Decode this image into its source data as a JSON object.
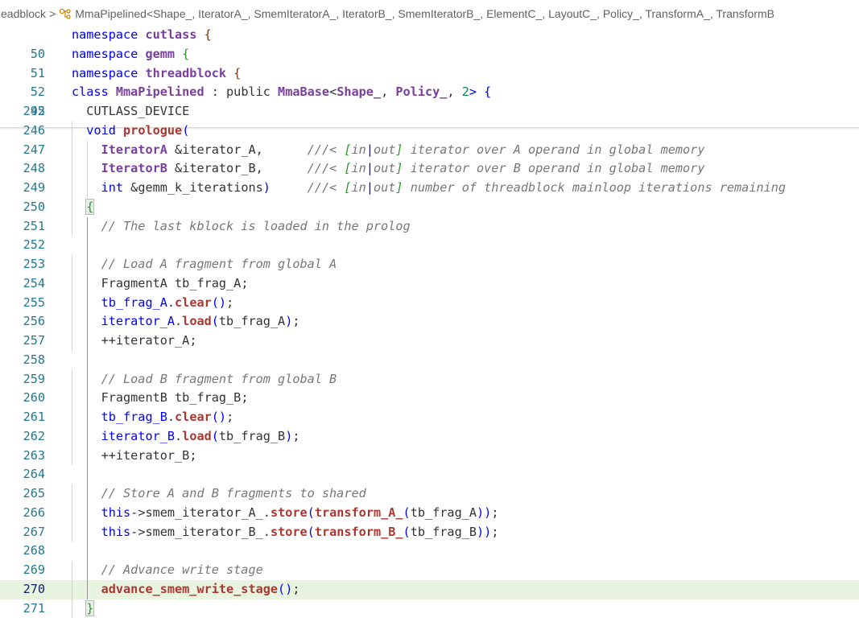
{
  "breadcrumb": {
    "prefix": "eadblock",
    "symbol": "MmaPipelined<Shape_, IteratorA_, SmemIteratorA_, IteratorB_, SmemIteratorB_, ElementC_, LayoutC_, Policy_, TransformA_, TransformB"
  },
  "sticky": [
    {
      "ln": "50",
      "parts": [
        "namespace ",
        "cutlass",
        " {"
      ]
    },
    {
      "ln": "51",
      "parts": [
        "namespace ",
        "gemm",
        " {"
      ]
    },
    {
      "ln": "52",
      "parts": [
        "namespace ",
        "threadblock",
        " {"
      ]
    },
    {
      "ln": "92",
      "parts": [
        "class ",
        "MmaPipelined",
        " : public ",
        "MmaBase",
        "<",
        "Shape_",
        ", ",
        "Policy_",
        ", ",
        "2",
        "> {"
      ]
    }
  ],
  "lines": [
    {
      "ln": "245",
      "text": "  CUTLASS_DEVICE"
    },
    {
      "ln": "246",
      "text": "  void prologue("
    },
    {
      "ln": "247",
      "text": "    IteratorA &iterator_A,      ///< [in|out] iterator over A operand in global memory"
    },
    {
      "ln": "248",
      "text": "    IteratorB &iterator_B,      ///< [in|out] iterator over B operand in global memory"
    },
    {
      "ln": "249",
      "text": "    int &gemm_k_iterations)     ///< [in|out] number of threadblock mainloop iterations remaining"
    },
    {
      "ln": "250",
      "text": "  {"
    },
    {
      "ln": "251",
      "text": "    // The last kblock is loaded in the prolog"
    },
    {
      "ln": "252",
      "text": ""
    },
    {
      "ln": "253",
      "text": "    // Load A fragment from global A"
    },
    {
      "ln": "254",
      "text": "    FragmentA tb_frag_A;"
    },
    {
      "ln": "255",
      "text": "    tb_frag_A.clear();"
    },
    {
      "ln": "256",
      "text": "    iterator_A.load(tb_frag_A);"
    },
    {
      "ln": "257",
      "text": "    ++iterator_A;"
    },
    {
      "ln": "258",
      "text": ""
    },
    {
      "ln": "259",
      "text": "    // Load B fragment from global B"
    },
    {
      "ln": "260",
      "text": "    FragmentB tb_frag_B;"
    },
    {
      "ln": "261",
      "text": "    tb_frag_B.clear();"
    },
    {
      "ln": "262",
      "text": "    iterator_B.load(tb_frag_B);"
    },
    {
      "ln": "263",
      "text": "    ++iterator_B;"
    },
    {
      "ln": "264",
      "text": ""
    },
    {
      "ln": "265",
      "text": "    // Store A and B fragments to shared"
    },
    {
      "ln": "266",
      "text": "    this->smem_iterator_A_.store(transform_A_(tb_frag_A));"
    },
    {
      "ln": "267",
      "text": "    this->smem_iterator_B_.store(transform_B_(tb_frag_B));"
    },
    {
      "ln": "268",
      "text": ""
    },
    {
      "ln": "269",
      "text": "    // Advance write stage"
    },
    {
      "ln": "270",
      "text": "    advance_smem_write_stage();"
    },
    {
      "ln": "271",
      "text": "  }"
    }
  ],
  "colors": {
    "line_number": "#237893",
    "active_line_number": "#0b216f",
    "current_line_highlight": "#e8f4e0",
    "comment": "#777777",
    "function": "#aa3731",
    "type": "#7a3e9d"
  },
  "active_line": "270"
}
